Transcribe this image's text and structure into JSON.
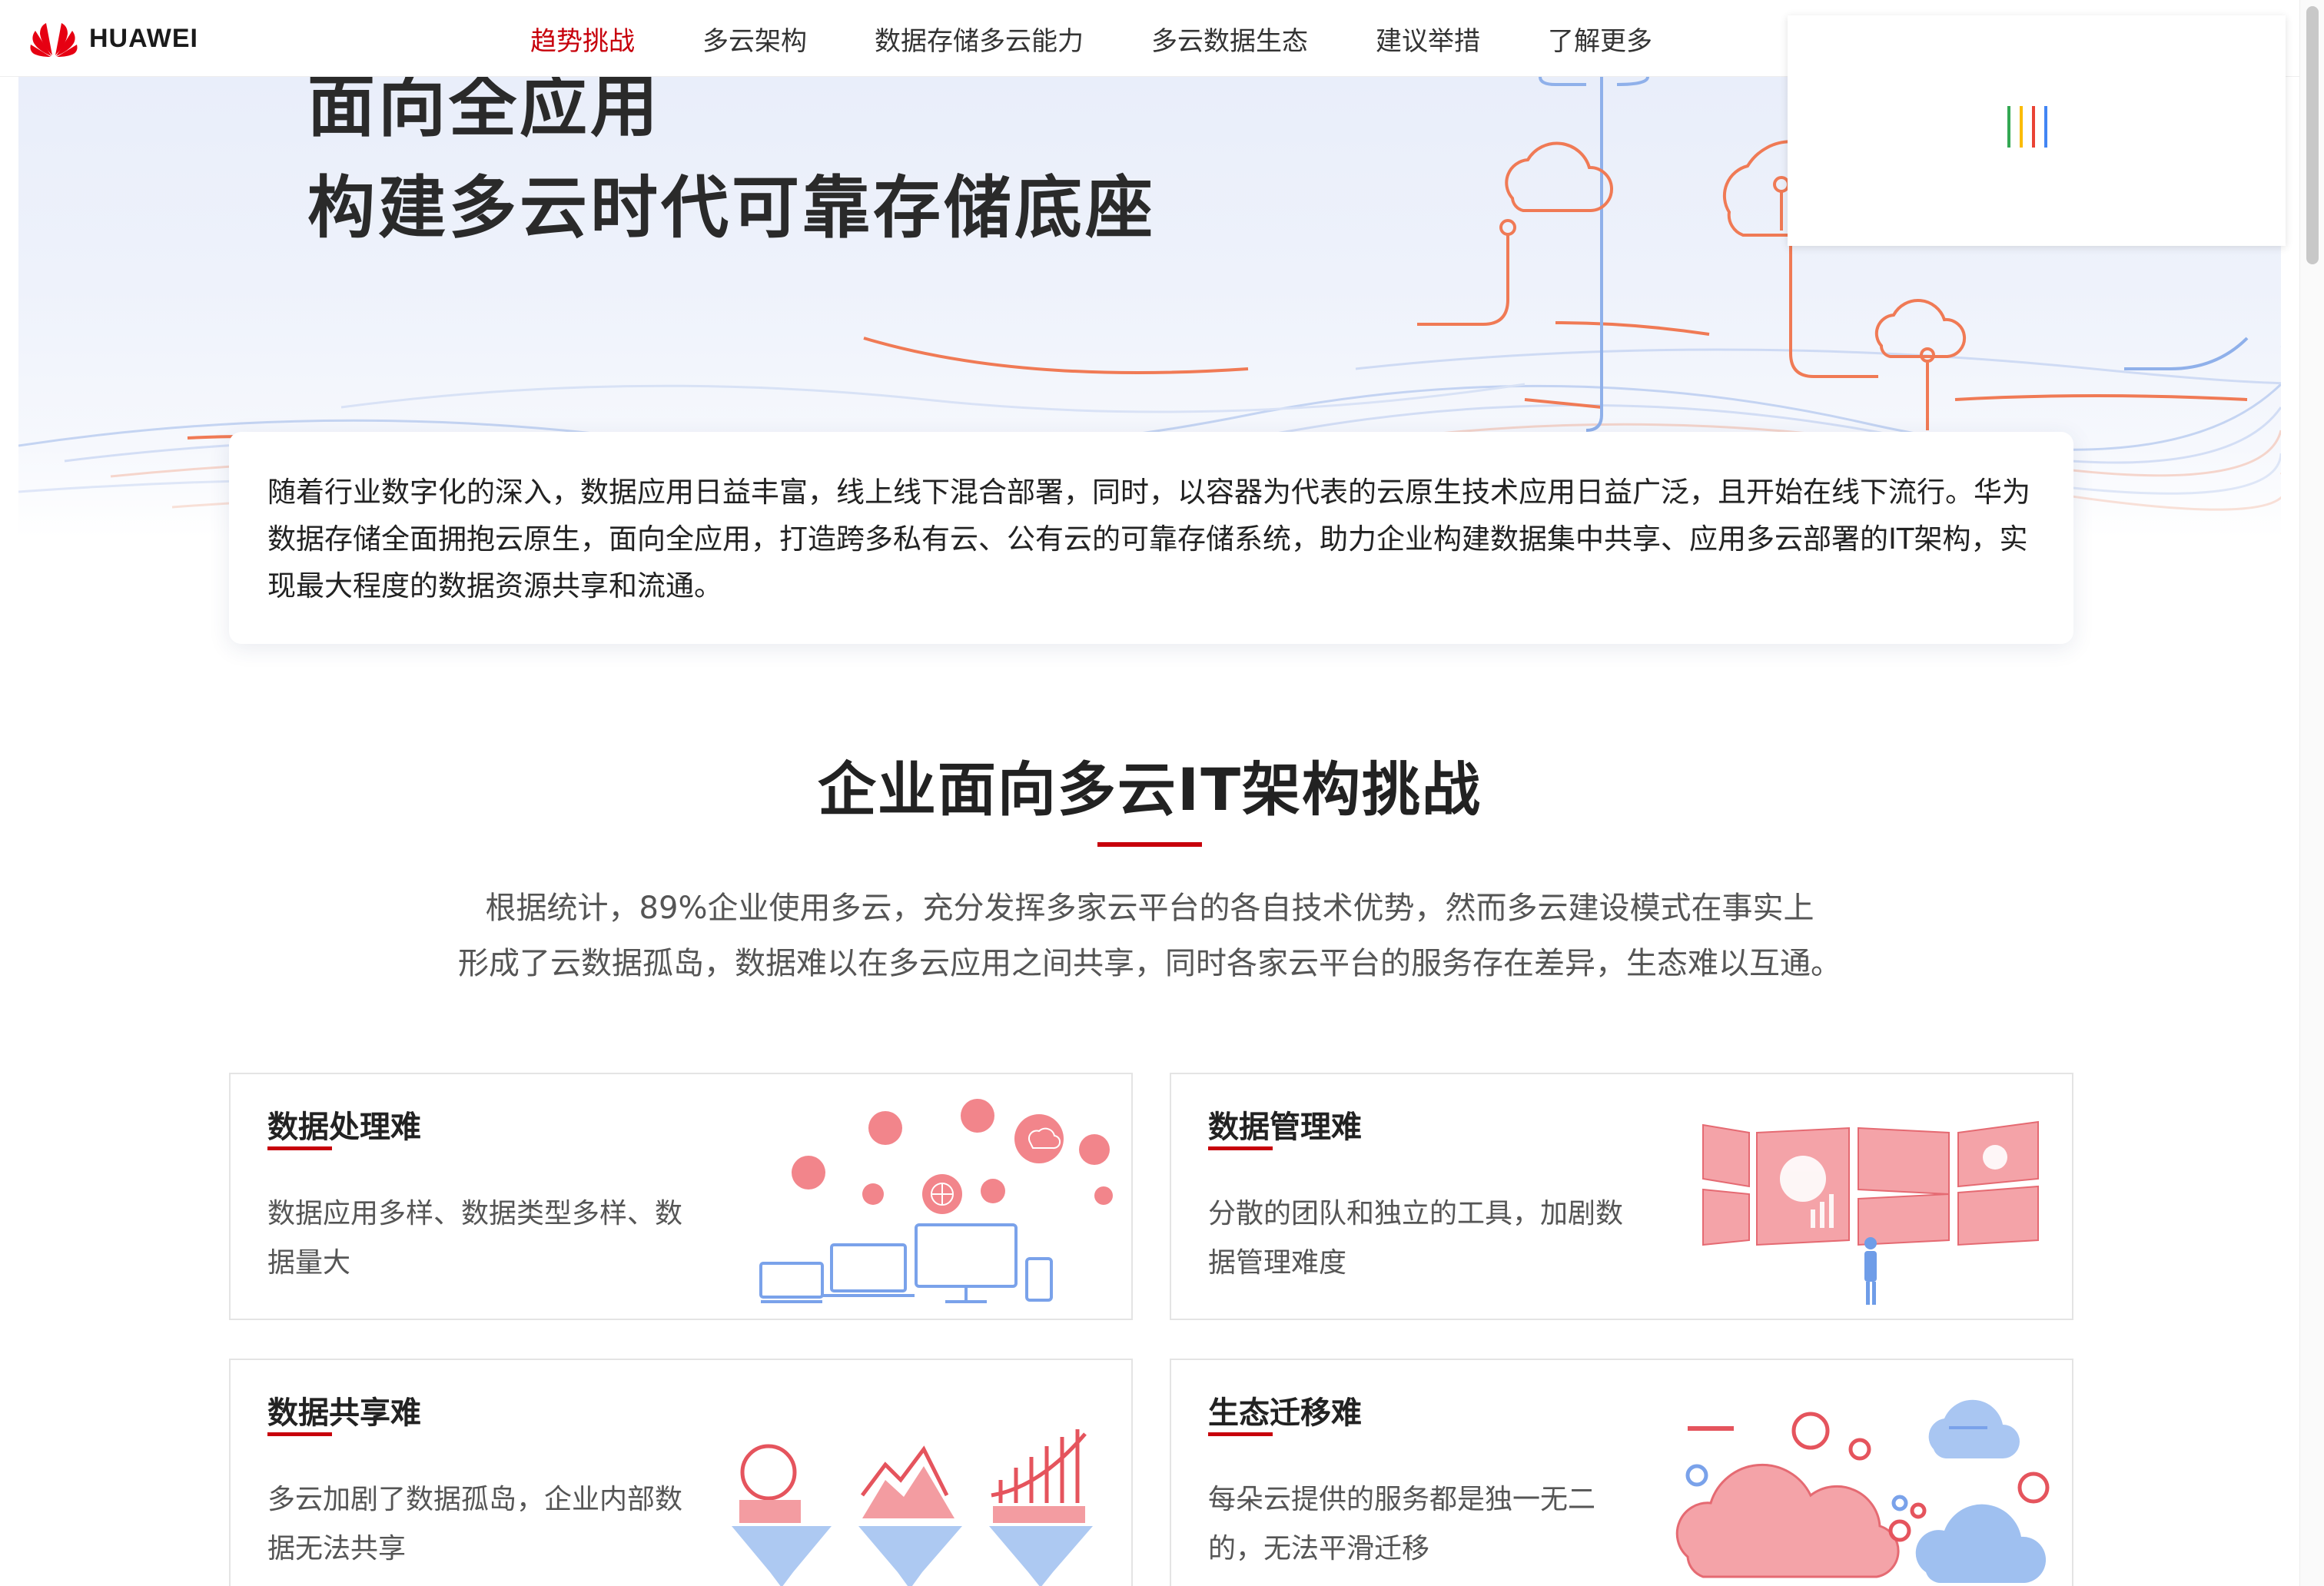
{
  "brand": {
    "name": "HUAWEI",
    "logo_icon": "huawei-petal-logo",
    "accent": "#c7000b"
  },
  "nav": {
    "items": [
      {
        "label": "趋势挑战",
        "active": true
      },
      {
        "label": "多云架构",
        "active": false
      },
      {
        "label": "数据存储多云能力",
        "active": false
      },
      {
        "label": "多云数据生态",
        "active": false
      },
      {
        "label": "建议举措",
        "active": false
      },
      {
        "label": "了解更多",
        "active": false
      }
    ]
  },
  "loading_popup": {
    "spinner_colors": [
      "#34a853",
      "#fbbc05",
      "#ea4335",
      "#4285f4"
    ]
  },
  "hero": {
    "title_line1": "面向全应用",
    "title_line2": "构建多云时代可靠存储底座",
    "intro": "随着行业数字化的深入，数据应用日益丰富，线上线下混合部署，同时，以容器为代表的云原生技术应用日益广泛，且开始在线下流行。华为数据存储全面拥抱云原生，面向全应用，打造跨多私有云、公有云的可靠存储系统，助力企业构建数据集中共享、应用多云部署的IT架构，实现最大程度的数据资源共享和流通。"
  },
  "challenges": {
    "title": "企业面向多云IT架构挑战",
    "desc_line1": "根据统计，89%企业使用多云，充分发挥多家云平台的各自技术优势，然而多云建设模式在事实上",
    "desc_line2": "形成了云数据孤岛，数据难以在多云应用之间共享，同时各家云平台的服务存在差异，生态难以互通。",
    "cards": [
      {
        "title": "数据处理难",
        "desc": "数据应用多样、数据类型多样、数据量大",
        "illustration": "devices-data-bubbles-illustration"
      },
      {
        "title": "数据管理难",
        "desc": "分散的团队和独立的工具，加剧数据管理难度",
        "illustration": "dashboard-screens-illustration"
      },
      {
        "title": "数据共享难",
        "desc": "多云加剧了数据孤岛，企业内部数据无法共享",
        "illustration": "data-islands-illustration"
      },
      {
        "title": "生态迁移难",
        "desc": "每朵云提供的服务都是独一无二的，无法平滑迁移",
        "illustration": "clouds-gears-illustration"
      }
    ]
  }
}
